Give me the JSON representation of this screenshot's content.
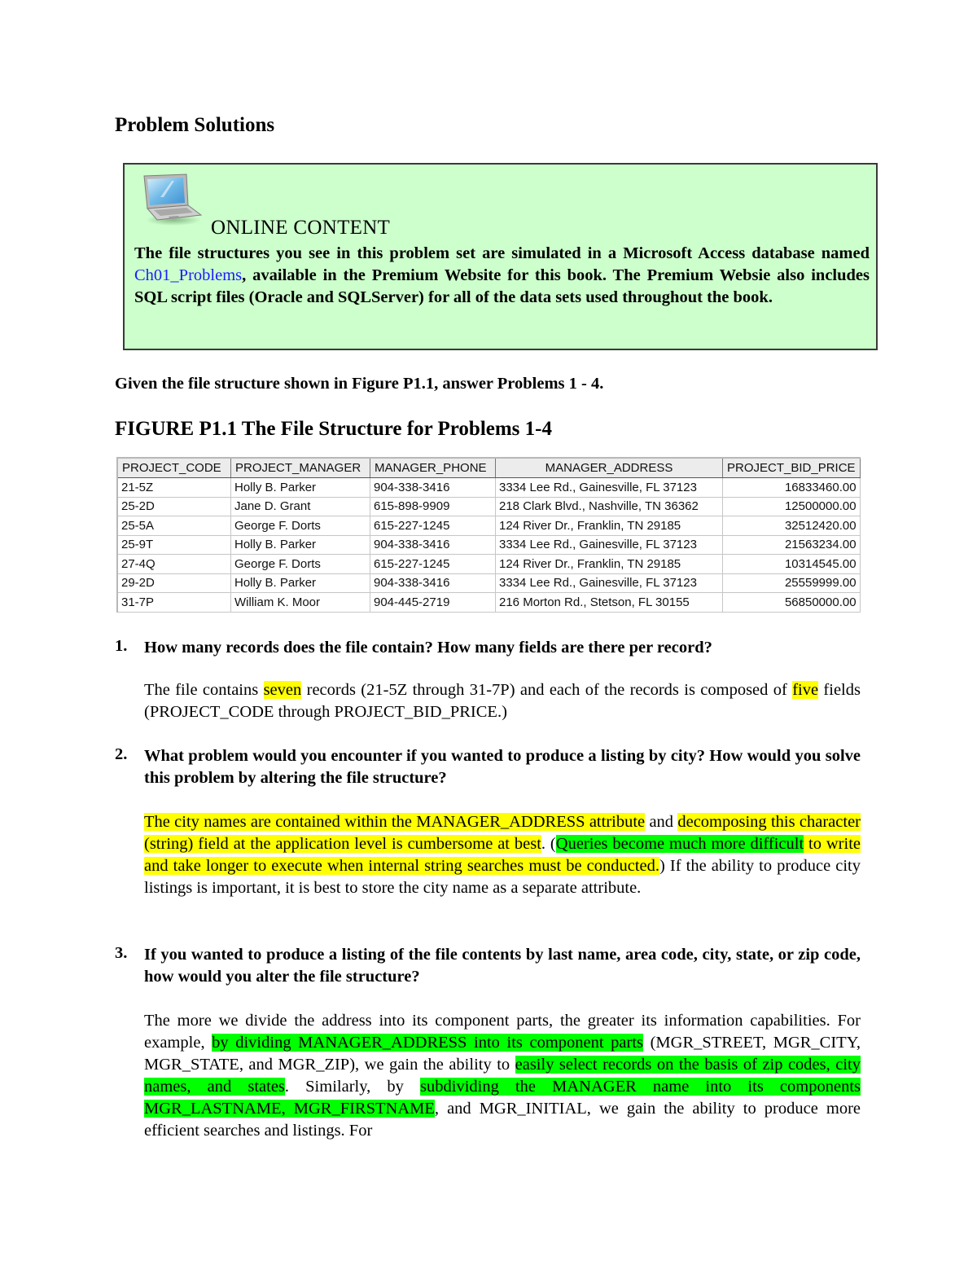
{
  "page_title": "Problem Solutions",
  "online_content": {
    "icon": "laptop-icon",
    "heading": "ONLINE CONTENT",
    "text_before_link": "The file structures you see in this problem set are simulated in a Microsoft Access database named ",
    "link_text": "Ch01_Problems",
    "text_after_link": ", available in the Premium Website for this book.  The Premium Websie also includes SQL script files (Oracle and SQLServer) for all of the data sets used throughout the book.",
    "background_color": "#ccffcc",
    "link_color": "#1a1aff"
  },
  "intro": "Given the file structure shown in Figure P1.1, answer Problems 1 - 4.",
  "figure": {
    "title": "FIGURE P1.1 The File Structure for Problems 1-4",
    "columns": [
      "PROJECT_CODE",
      "PROJECT_MANAGER",
      "MANAGER_PHONE",
      "MANAGER_ADDRESS",
      "PROJECT_BID_PRICE"
    ],
    "rows": [
      [
        "21-5Z",
        "Holly B. Parker",
        "904-338-3416",
        "3334 Lee Rd., Gainesville, FL  37123",
        "16833460.00"
      ],
      [
        "25-2D",
        "Jane D. Grant",
        "615-898-9909",
        "218 Clark Blvd., Nashville, TN  36362",
        "12500000.00"
      ],
      [
        "25-5A",
        "George F. Dorts",
        "615-227-1245",
        "124 River Dr., Franklin, TN  29185",
        "32512420.00"
      ],
      [
        "25-9T",
        "Holly B. Parker",
        "904-338-3416",
        "3334 Lee Rd., Gainesville, FL  37123",
        "21563234.00"
      ],
      [
        "27-4Q",
        "George F. Dorts",
        "615-227-1245",
        "124 River Dr., Franklin, TN  29185",
        "10314545.00"
      ],
      [
        "29-2D",
        "Holly B. Parker",
        "904-338-3416",
        "3334 Lee Rd., Gainesville, FL  37123",
        "25559999.00"
      ],
      [
        "31-7P",
        "William K. Moor",
        "904-445-2719",
        "216 Morton Rd., Stetson, FL  30155",
        "56850000.00"
      ]
    ]
  },
  "highlight_colors": {
    "yellow": "#ffff00",
    "green": "#00ff00"
  },
  "questions": [
    {
      "number": "1.",
      "question": "How many records does the file contain? How many fields are there per record?",
      "answer_segments": [
        {
          "text": "The file contains ",
          "hl": ""
        },
        {
          "text": "seven",
          "hl": "yellow"
        },
        {
          "text": " records (21-5Z through 31-7P) and each of the records is composed of ",
          "hl": ""
        },
        {
          "text": "five",
          "hl": "yellow"
        },
        {
          "text": " fields (PROJECT_CODE through PROJECT_BID_PRICE.)",
          "hl": ""
        }
      ]
    },
    {
      "number": "2.",
      "question": "What problem would you encounter if you wanted to produce a listing by city? How would you solve this problem by altering the file structure?",
      "answer_segments": [
        {
          "text": "The city names are contained within the MANAGER_ADDRESS attribute",
          "hl": "yellow"
        },
        {
          "text": " and ",
          "hl": ""
        },
        {
          "text": "decomposing this character (string) field at the application level is cumbersome at best",
          "hl": "yellow"
        },
        {
          "text": ". (",
          "hl": ""
        },
        {
          "text": "Queries become much more difficult",
          "hl": "green"
        },
        {
          "text": " to write and take longer to execute when internal string searches must be conducted.",
          "hl": "yellow"
        },
        {
          "text": ") If the ability to produce city listings is important, it is best to store the city name as a separate attribute.",
          "hl": ""
        }
      ]
    },
    {
      "number": "3.",
      "question": "If you wanted to produce a listing of the file contents by last name, area code, city, state, or zip code, how would you alter the file structure?",
      "answer_segments": [
        {
          "text": "The more we divide the address into its component parts, the greater its information capabilities. For example, ",
          "hl": ""
        },
        {
          "text": "by dividing MANAGER_ADDRESS into its component parts",
          "hl": "green"
        },
        {
          "text": " (MGR_STREET, MGR_CITY, MGR_STATE, and MGR_ZIP), we gain the ability to ",
          "hl": ""
        },
        {
          "text": "easily select records on the basis of zip codes, city names, and states",
          "hl": "green"
        },
        {
          "text": ". Similarly, by ",
          "hl": ""
        },
        {
          "text": "subdividing the MANAGER name into its components MGR_LASTNAME, MGR_FIRSTNAME",
          "hl": "green"
        },
        {
          "text": ", and MGR_INITIAL, we gain the ability to produce more efficient searches and listings. For",
          "hl": ""
        }
      ]
    }
  ]
}
